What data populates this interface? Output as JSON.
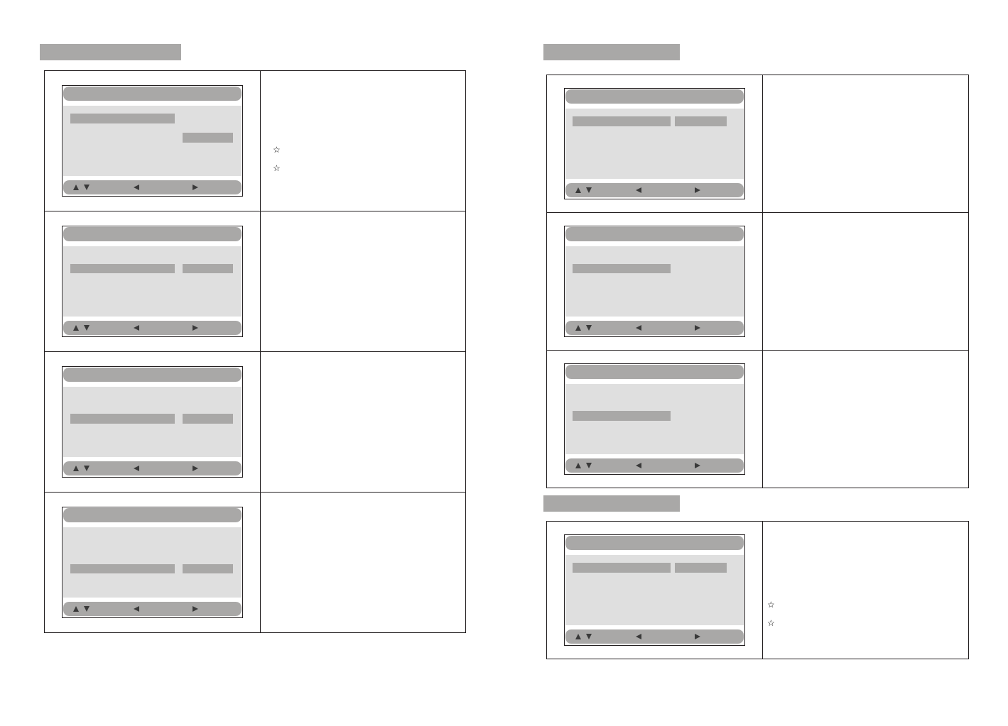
{
  "pages": [
    {
      "sections": [
        {
          "entries": [
            {
              "screen": {
                "rows": [
                  {
                    "label_highlighted": true,
                    "value_highlighted": false
                  },
                  {
                    "label_highlighted": false,
                    "value_highlighted": false
                  },
                  {
                    "label_highlighted": false,
                    "value_highlighted": true
                  }
                ]
              },
              "notes": [
                "☆",
                "☆"
              ]
            },
            {
              "screen": {
                "rows": [
                  {
                    "label_highlighted": false,
                    "value_highlighted": false
                  },
                  {
                    "label_highlighted": true,
                    "value_highlighted": true
                  }
                ]
              }
            },
            {
              "screen": {
                "rows": [
                  {
                    "label_highlighted": false,
                    "value_highlighted": false
                  },
                  {
                    "label_highlighted": false,
                    "value_highlighted": false
                  },
                  {
                    "label_highlighted": true,
                    "value_highlighted": true
                  }
                ]
              }
            },
            {
              "screen": {
                "rows": [
                  {
                    "label_highlighted": false,
                    "value_highlighted": false
                  },
                  {
                    "label_highlighted": false,
                    "value_highlighted": false
                  },
                  {
                    "label_highlighted": false,
                    "value_highlighted": false
                  },
                  {
                    "label_highlighted": true,
                    "value_highlighted": true
                  }
                ]
              }
            }
          ]
        }
      ]
    },
    {
      "sections": [
        {
          "entries": [
            {
              "screen": {
                "rows": [
                  {
                    "label_highlighted": true,
                    "value_highlighted": true
                  }
                ]
              }
            },
            {
              "screen": {
                "rows": [
                  {
                    "label_highlighted": false,
                    "value_highlighted": false
                  },
                  {
                    "label_highlighted": true,
                    "value_highlighted": false
                  }
                ]
              }
            },
            {
              "screen": {
                "rows": [
                  {
                    "label_highlighted": false,
                    "value_highlighted": false
                  },
                  {
                    "label_highlighted": false,
                    "value_highlighted": false
                  },
                  {
                    "label_highlighted": true,
                    "value_highlighted": false
                  }
                ]
              }
            }
          ]
        },
        {
          "entries": [
            {
              "screen": {
                "rows": [
                  {
                    "label_highlighted": true,
                    "value_highlighted": true
                  }
                ]
              },
              "notes": [
                "☆",
                "☆"
              ]
            }
          ]
        }
      ]
    }
  ]
}
